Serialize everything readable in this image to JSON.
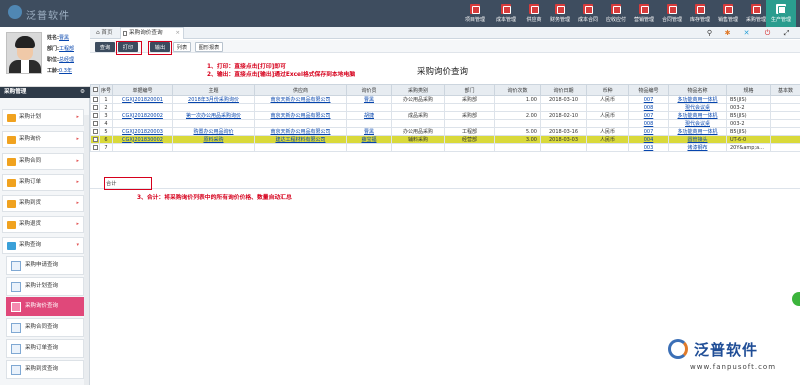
{
  "app": {
    "logo_text": "泛普软件"
  },
  "topnav": [
    {
      "label": "项目管理"
    },
    {
      "label": "成本管理"
    },
    {
      "label": "供应商"
    },
    {
      "label": "财务管理"
    },
    {
      "label": "成本合同"
    },
    {
      "label": "应收应付"
    },
    {
      "label": "营销管理"
    },
    {
      "label": "合同管理"
    },
    {
      "label": "库存管理"
    },
    {
      "label": "销售管理"
    },
    {
      "label": "采购管理"
    },
    {
      "label": "生产管理"
    },
    {
      "label": "更多"
    }
  ],
  "tabs": {
    "home": "首页",
    "current": "采购询价查询"
  },
  "user": {
    "name_label": "姓名:",
    "name": "曹黑",
    "dept_label": "部门:",
    "dept": "工程部",
    "role_label": "职位:",
    "role": "总经理",
    "salary_label": "工龄:",
    "salary": "0.3年"
  },
  "sidebar": {
    "module_title": "采购管理",
    "menus": [
      {
        "label": "采购计划"
      },
      {
        "label": "采购询价"
      },
      {
        "label": "采购合同"
      },
      {
        "label": "采购订单"
      },
      {
        "label": "采购到货"
      },
      {
        "label": "采购退货"
      },
      {
        "label": "采购查询"
      }
    ],
    "subs": [
      {
        "label": "采购申请查询"
      },
      {
        "label": "采购计划查询"
      },
      {
        "label": "采购询价查询"
      },
      {
        "label": "采购合同查询"
      },
      {
        "label": "采购订单查询"
      },
      {
        "label": "采购到货查询"
      }
    ]
  },
  "toolbar": {
    "query": "查询",
    "print": "打印",
    "export": "输出",
    "list": "列表",
    "chart": "图形报表"
  },
  "page": {
    "title": "采购询价查询"
  },
  "annotations": {
    "a1": "1、打印：直接点击[打印]即可",
    "a2": "2、输出：直接点击[输出]通过Excel格式保存到本地电脑",
    "a3": "3、合计：将采购询价列表中的所有询价价格、数量自动汇总"
  },
  "table": {
    "headers": [
      "序号",
      "单据编号",
      "主题",
      "供应商",
      "询价员",
      "采购类别",
      "部门",
      "询价次数",
      "询价日期",
      "币种",
      "物品编号",
      "物品名称",
      "规格",
      "基本数"
    ],
    "rows": [
      {
        "no": "1",
        "code": "CGXJ201820001",
        "subject": "2018年3月份采购询价",
        "supplier": "南京天新办公用品有限公司",
        "staff": "曹黑",
        "category": "办公用品采购",
        "dept": "采购部",
        "times": "1.00",
        "date": "2018-03-10",
        "currency": "人民币",
        "item_code": "007",
        "item_name": "多功能商用一体机",
        "spec": "B5(JIS)"
      },
      {
        "no": "2",
        "code": "",
        "subject": "",
        "supplier": "",
        "staff": "",
        "category": "",
        "dept": "",
        "times": "",
        "date": "",
        "currency": "",
        "item_code": "008",
        "item_name": "現代会议桌",
        "spec": "003-2"
      },
      {
        "no": "3",
        "code": "CGXJ201820002",
        "subject": "第一次办公用品采购询价",
        "supplier": "南京天新办公用品有限公司",
        "staff": "胡捷",
        "category": "成品采购",
        "dept": "采购部",
        "times": "2.00",
        "date": "2018-02-10",
        "currency": "人民币",
        "item_code": "007",
        "item_name": "多功能商用一体机",
        "spec": "B5(JIS)"
      },
      {
        "no": "4",
        "code": "",
        "subject": "",
        "supplier": "",
        "staff": "",
        "category": "",
        "dept": "",
        "times": "",
        "date": "",
        "currency": "",
        "item_code": "008",
        "item_name": "現代会议桌",
        "spec": "003-2"
      },
      {
        "no": "5",
        "code": "CGXJ201820003",
        "subject": "购置办公用品询价",
        "supplier": "南京天新办公用品有限公司",
        "staff": "曹黑",
        "category": "办公用品采购",
        "dept": "工程部",
        "times": "5.00",
        "date": "2018-03-16",
        "currency": "人民币",
        "item_code": "007",
        "item_name": "多功能商用一体机",
        "spec": "B5(JIS)"
      },
      {
        "no": "6",
        "code": "CGXJ201830002",
        "subject": "原料采购",
        "supplier": "建达工程材料有限公司",
        "staff": "薛宝福",
        "category": "辅料采购",
        "dept": "经营部",
        "times": "3.00",
        "date": "2018-03-03",
        "currency": "人民币",
        "item_code": "004",
        "item_name": "圆管接头",
        "spec": "UT-6-0"
      },
      {
        "no": "7",
        "code": "",
        "subject": "",
        "supplier": "",
        "staff": "",
        "category": "",
        "dept": "",
        "times": "",
        "date": "",
        "currency": "",
        "item_code": "003",
        "item_name": "烤漆钢布",
        "spec": "20Y&amp;a..."
      }
    ],
    "sum_label": "合计"
  },
  "footer": {
    "brand": "泛普软件",
    "url": "www.fanpusoft.com"
  }
}
